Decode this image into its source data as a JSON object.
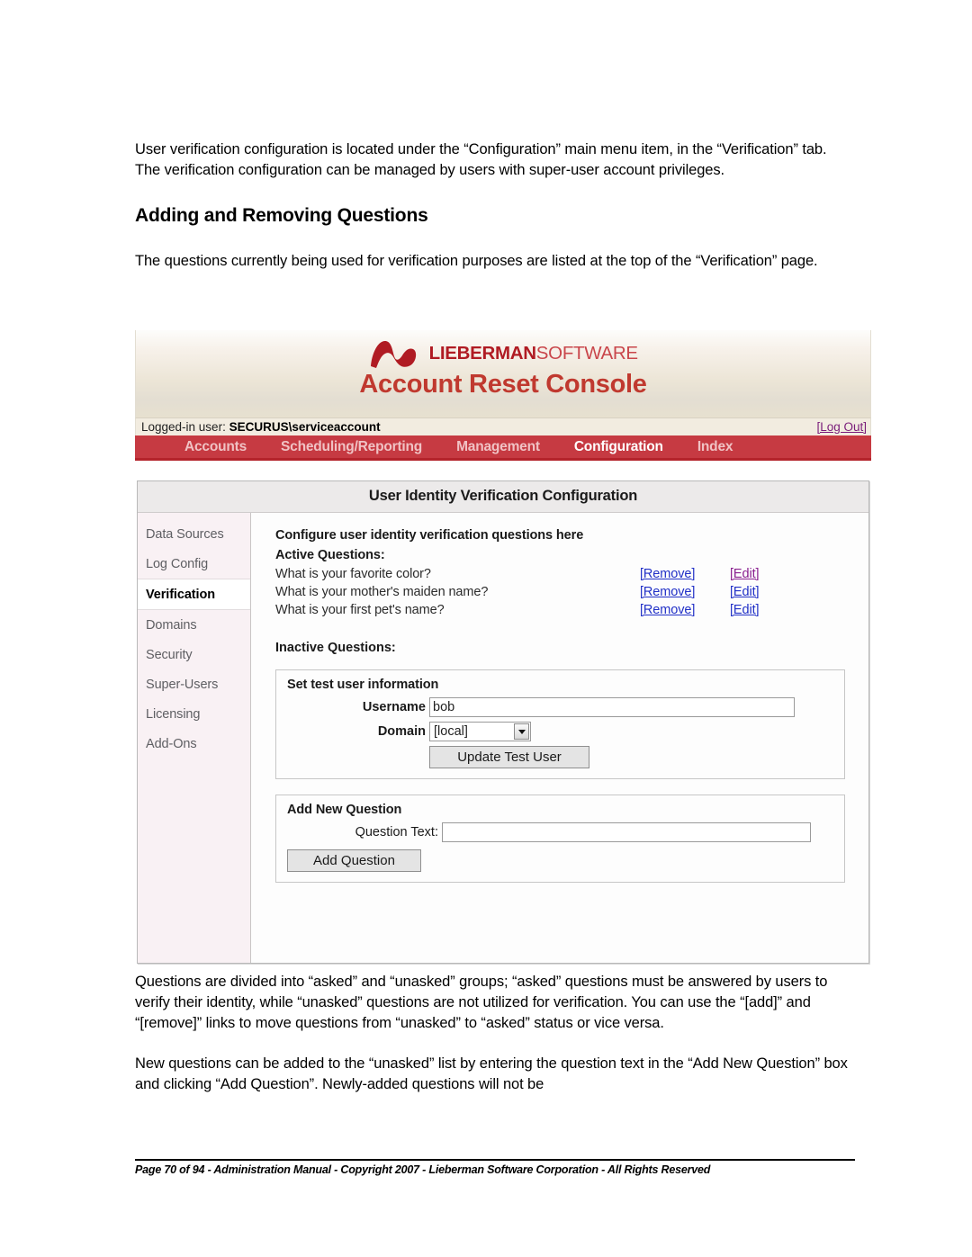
{
  "document": {
    "paragraph_1": "User verification configuration is located under the “Configuration” main menu item, in the “Verification” tab.  The verification configuration can be managed by users with super-user account privileges.",
    "heading_1": "Adding and Removing Questions",
    "paragraph_2": "The questions currently being used for verification purposes are listed at the top of the “Verification” page.",
    "paragraph_3": "Questions are divided into “asked” and “unasked” groups; “asked” questions must be answered by users to verify their identity, while “unasked” questions are not utilized for verification.  You can use the “[add]” and “[remove]” links to move questions from “unasked” to “asked” status or vice versa.",
    "paragraph_4": "New questions can be added to the “unasked” list by entering the question text in the “Add New Question” box and clicking “Add Question”.  Newly-added questions will not be",
    "footer": "Page 70 of 94 - Administration Manual - Copyright 2007 - Lieberman Software Corporation - All Rights Reserved"
  },
  "app": {
    "brand": {
      "name_bold": "LIEBERMAN",
      "name_light": "SOFTWARE",
      "logo_icon": "lieberman-wave-logo"
    },
    "title": "Account Reset Console",
    "login_bar": {
      "label": "Logged-in user:",
      "user": "SECURUS\\serviceaccount",
      "logout": "[Log Out]"
    },
    "nav": [
      {
        "label": "Accounts",
        "active": false
      },
      {
        "label": "Scheduling/Reporting",
        "active": false
      },
      {
        "label": "Management",
        "active": false
      },
      {
        "label": "Configuration",
        "active": true
      },
      {
        "label": "Index",
        "active": false
      }
    ],
    "panel": {
      "title": "User Identity Verification Configuration",
      "sidebar": [
        {
          "label": "Data Sources",
          "active": false
        },
        {
          "label": "Log Config",
          "active": false
        },
        {
          "label": "Verification",
          "active": true
        },
        {
          "label": "Domains",
          "active": false
        },
        {
          "label": "Security",
          "active": false
        },
        {
          "label": "Super-Users",
          "active": false
        },
        {
          "label": "Licensing",
          "active": false
        },
        {
          "label": "Add-Ons",
          "active": false
        }
      ],
      "content": {
        "intro": "Configure user identity verification questions here",
        "active_questions_label": "Active Questions:",
        "questions": [
          {
            "text": "What is your favorite color?",
            "remove": "[Remove]",
            "edit": "[Edit]"
          },
          {
            "text": "What is your mother's maiden name?",
            "remove": "[Remove]",
            "edit": "[Edit]"
          },
          {
            "text": "What is your first pet's name?",
            "remove": "[Remove]",
            "edit": "[Edit]"
          }
        ],
        "inactive_questions_label": "Inactive Questions:",
        "test_user_box": {
          "legend": "Set test user information",
          "username_label": "Username",
          "username_value": "bob",
          "domain_label": "Domain",
          "domain_value": "[local]",
          "update_button": "Update Test User"
        },
        "add_question_box": {
          "legend": "Add New Question",
          "question_label": "Question Text:",
          "question_value": "",
          "add_button": "Add Question"
        }
      }
    },
    "colors": {
      "nav_bar": "#c63a42",
      "title_red": "#c0392f",
      "brand_red": "#b01b23",
      "link_blue": "#2130c7",
      "link_purple": "#8a2090",
      "sidebar_bg": "#f9f1f4"
    }
  }
}
